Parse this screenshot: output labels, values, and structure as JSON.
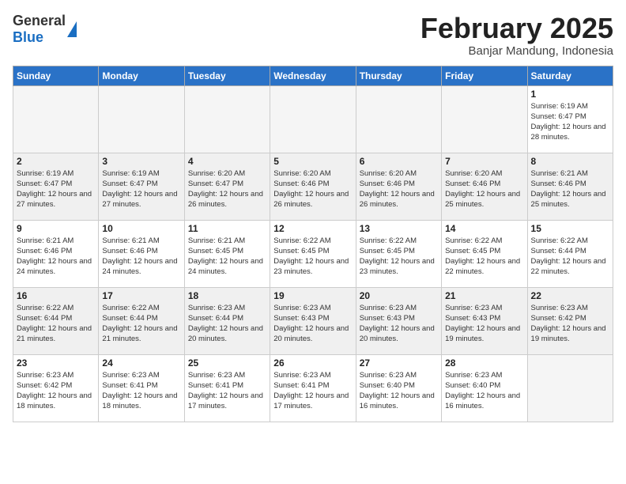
{
  "logo": {
    "general": "General",
    "blue": "Blue"
  },
  "title": "February 2025",
  "subtitle": "Banjar Mandung, Indonesia",
  "days_of_week": [
    "Sunday",
    "Monday",
    "Tuesday",
    "Wednesday",
    "Thursday",
    "Friday",
    "Saturday"
  ],
  "weeks": [
    {
      "shade": false,
      "days": [
        {
          "num": "",
          "info": ""
        },
        {
          "num": "",
          "info": ""
        },
        {
          "num": "",
          "info": ""
        },
        {
          "num": "",
          "info": ""
        },
        {
          "num": "",
          "info": ""
        },
        {
          "num": "",
          "info": ""
        },
        {
          "num": "1",
          "info": "Sunrise: 6:19 AM\nSunset: 6:47 PM\nDaylight: 12 hours and 28 minutes."
        }
      ]
    },
    {
      "shade": true,
      "days": [
        {
          "num": "2",
          "info": "Sunrise: 6:19 AM\nSunset: 6:47 PM\nDaylight: 12 hours and 27 minutes."
        },
        {
          "num": "3",
          "info": "Sunrise: 6:19 AM\nSunset: 6:47 PM\nDaylight: 12 hours and 27 minutes."
        },
        {
          "num": "4",
          "info": "Sunrise: 6:20 AM\nSunset: 6:47 PM\nDaylight: 12 hours and 26 minutes."
        },
        {
          "num": "5",
          "info": "Sunrise: 6:20 AM\nSunset: 6:46 PM\nDaylight: 12 hours and 26 minutes."
        },
        {
          "num": "6",
          "info": "Sunrise: 6:20 AM\nSunset: 6:46 PM\nDaylight: 12 hours and 26 minutes."
        },
        {
          "num": "7",
          "info": "Sunrise: 6:20 AM\nSunset: 6:46 PM\nDaylight: 12 hours and 25 minutes."
        },
        {
          "num": "8",
          "info": "Sunrise: 6:21 AM\nSunset: 6:46 PM\nDaylight: 12 hours and 25 minutes."
        }
      ]
    },
    {
      "shade": false,
      "days": [
        {
          "num": "9",
          "info": "Sunrise: 6:21 AM\nSunset: 6:46 PM\nDaylight: 12 hours and 24 minutes."
        },
        {
          "num": "10",
          "info": "Sunrise: 6:21 AM\nSunset: 6:46 PM\nDaylight: 12 hours and 24 minutes."
        },
        {
          "num": "11",
          "info": "Sunrise: 6:21 AM\nSunset: 6:45 PM\nDaylight: 12 hours and 24 minutes."
        },
        {
          "num": "12",
          "info": "Sunrise: 6:22 AM\nSunset: 6:45 PM\nDaylight: 12 hours and 23 minutes."
        },
        {
          "num": "13",
          "info": "Sunrise: 6:22 AM\nSunset: 6:45 PM\nDaylight: 12 hours and 23 minutes."
        },
        {
          "num": "14",
          "info": "Sunrise: 6:22 AM\nSunset: 6:45 PM\nDaylight: 12 hours and 22 minutes."
        },
        {
          "num": "15",
          "info": "Sunrise: 6:22 AM\nSunset: 6:44 PM\nDaylight: 12 hours and 22 minutes."
        }
      ]
    },
    {
      "shade": true,
      "days": [
        {
          "num": "16",
          "info": "Sunrise: 6:22 AM\nSunset: 6:44 PM\nDaylight: 12 hours and 21 minutes."
        },
        {
          "num": "17",
          "info": "Sunrise: 6:22 AM\nSunset: 6:44 PM\nDaylight: 12 hours and 21 minutes."
        },
        {
          "num": "18",
          "info": "Sunrise: 6:23 AM\nSunset: 6:44 PM\nDaylight: 12 hours and 20 minutes."
        },
        {
          "num": "19",
          "info": "Sunrise: 6:23 AM\nSunset: 6:43 PM\nDaylight: 12 hours and 20 minutes."
        },
        {
          "num": "20",
          "info": "Sunrise: 6:23 AM\nSunset: 6:43 PM\nDaylight: 12 hours and 20 minutes."
        },
        {
          "num": "21",
          "info": "Sunrise: 6:23 AM\nSunset: 6:43 PM\nDaylight: 12 hours and 19 minutes."
        },
        {
          "num": "22",
          "info": "Sunrise: 6:23 AM\nSunset: 6:42 PM\nDaylight: 12 hours and 19 minutes."
        }
      ]
    },
    {
      "shade": false,
      "days": [
        {
          "num": "23",
          "info": "Sunrise: 6:23 AM\nSunset: 6:42 PM\nDaylight: 12 hours and 18 minutes."
        },
        {
          "num": "24",
          "info": "Sunrise: 6:23 AM\nSunset: 6:41 PM\nDaylight: 12 hours and 18 minutes."
        },
        {
          "num": "25",
          "info": "Sunrise: 6:23 AM\nSunset: 6:41 PM\nDaylight: 12 hours and 17 minutes."
        },
        {
          "num": "26",
          "info": "Sunrise: 6:23 AM\nSunset: 6:41 PM\nDaylight: 12 hours and 17 minutes."
        },
        {
          "num": "27",
          "info": "Sunrise: 6:23 AM\nSunset: 6:40 PM\nDaylight: 12 hours and 16 minutes."
        },
        {
          "num": "28",
          "info": "Sunrise: 6:23 AM\nSunset: 6:40 PM\nDaylight: 12 hours and 16 minutes."
        },
        {
          "num": "",
          "info": ""
        }
      ]
    }
  ]
}
